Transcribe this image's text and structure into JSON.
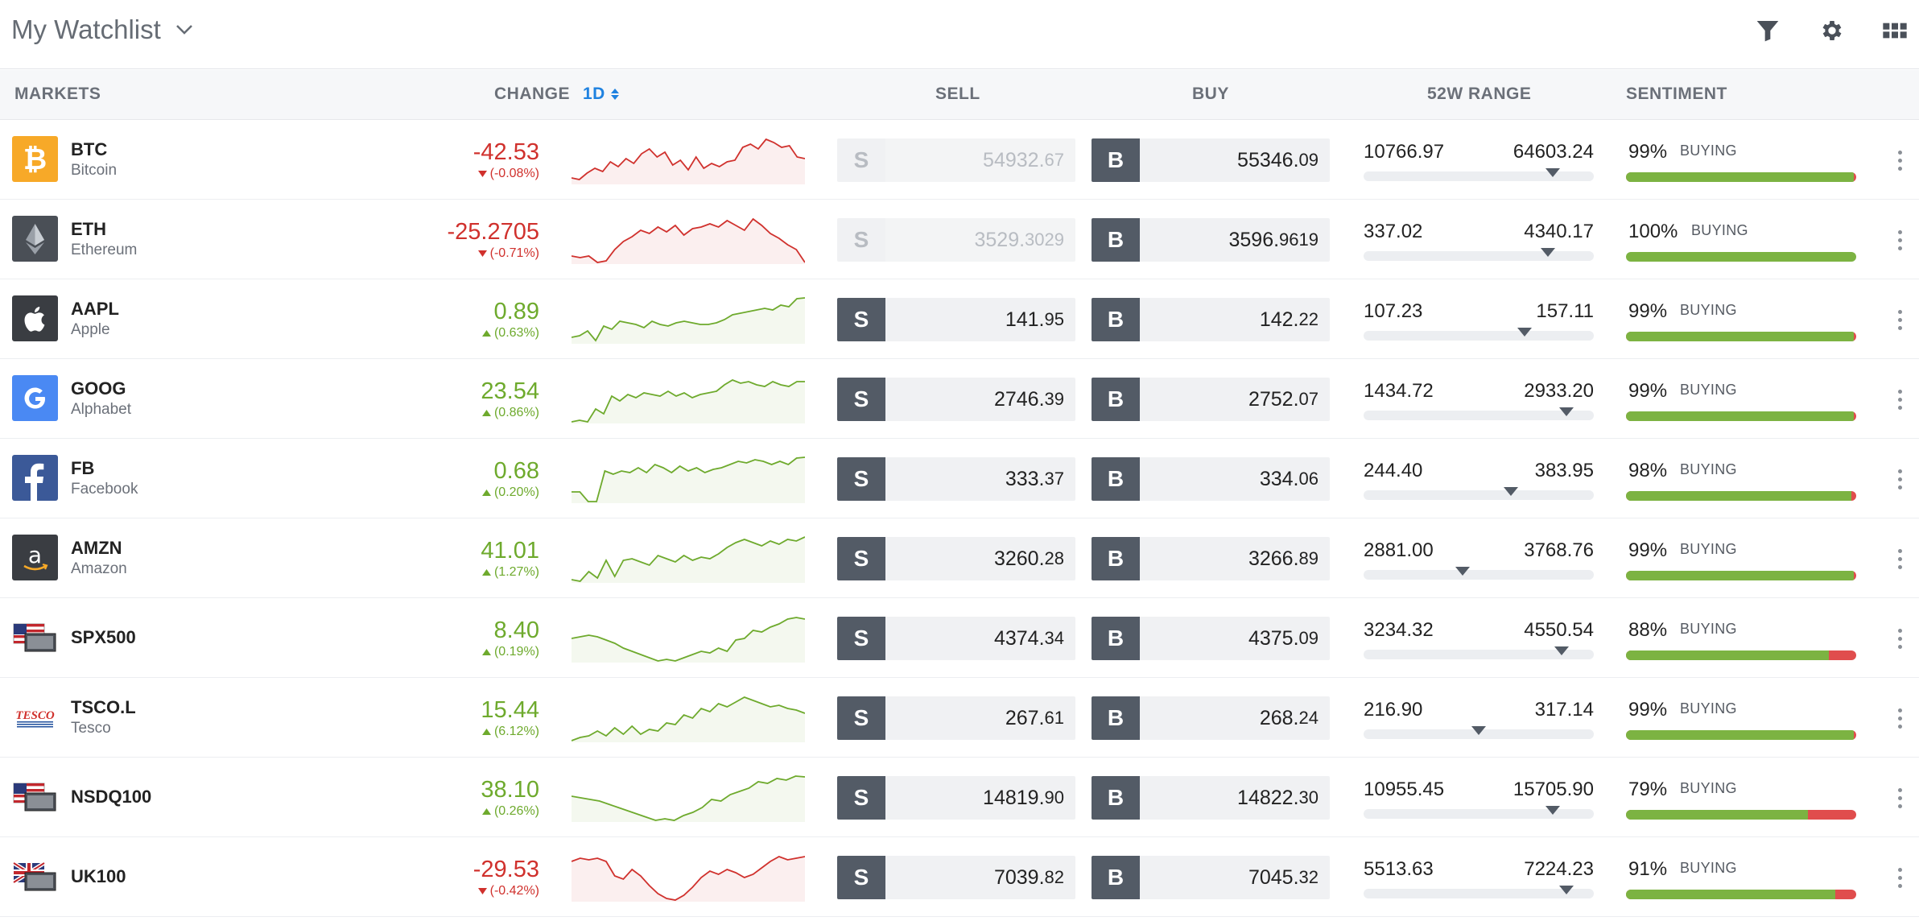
{
  "header": {
    "title": "My Watchlist",
    "icons": [
      "filter-icon",
      "gear-icon",
      "grid-icon"
    ]
  },
  "columns": {
    "markets": "MARKETS",
    "change": "CHANGE",
    "period": "1D",
    "sell": "SELL",
    "buy": "BUY",
    "range": "52W RANGE",
    "sentiment": "SENTIMENT"
  },
  "colors": {
    "positive": "#6eaa2d",
    "negative": "#d0312d",
    "button": "#535b66",
    "sentiment_buy": "#7cb342",
    "sentiment_sell": "#e04d4d"
  },
  "rows": [
    {
      "symbol": "BTC",
      "name": "Bitcoin",
      "logo": "bitcoin-logo-icon",
      "change": "-42.53",
      "change_pct": "(-0.08%)",
      "direction": "down",
      "sell_label": "S",
      "sell_main": "54932.",
      "sell_tail": "67",
      "sell_disabled": true,
      "buy_label": "B",
      "buy_main": "55346.",
      "buy_tail": "09",
      "range_low": "10766.97",
      "range_high": "64603.24",
      "range_pos": 0.82,
      "sentiment_pct": "99%",
      "sentiment_label": "BUYING",
      "sentiment_value": 99,
      "spark": [
        50,
        52,
        44,
        38,
        42,
        30,
        36,
        26,
        32,
        20,
        14,
        24,
        18,
        34,
        28,
        40,
        24,
        38,
        32,
        36,
        30,
        28,
        12,
        8,
        14,
        2,
        6,
        12,
        10,
        24,
        26
      ]
    },
    {
      "symbol": "ETH",
      "name": "Ethereum",
      "logo": "ethereum-logo-icon",
      "change": "-25.2705",
      "change_pct": "(-0.71%)",
      "direction": "down",
      "sell_label": "S",
      "sell_main": "3529.",
      "sell_tail": "3029",
      "sell_disabled": true,
      "buy_label": "B",
      "buy_main": "3596.",
      "buy_tail": "9619",
      "range_low": "337.02",
      "range_high": "4340.17",
      "range_pos": 0.8,
      "sentiment_pct": "100%",
      "sentiment_label": "BUYING",
      "sentiment_value": 100,
      "spark": [
        48,
        50,
        48,
        56,
        54,
        40,
        30,
        24,
        16,
        20,
        12,
        18,
        10,
        22,
        14,
        12,
        8,
        12,
        4,
        10,
        16,
        2,
        10,
        20,
        26,
        34,
        40,
        56
      ]
    },
    {
      "symbol": "AAPL",
      "name": "Apple",
      "logo": "apple-logo-icon",
      "change": "0.89",
      "change_pct": "(0.63%)",
      "direction": "up",
      "sell_label": "S",
      "sell_main": "141.",
      "sell_tail": "95",
      "sell_disabled": false,
      "buy_label": "B",
      "buy_main": "142.",
      "buy_tail": "22",
      "range_low": "107.23",
      "range_high": "157.11",
      "range_pos": 0.7,
      "sentiment_pct": "99%",
      "sentiment_label": "BUYING",
      "sentiment_value": 99,
      "spark": [
        50,
        48,
        42,
        54,
        36,
        40,
        30,
        32,
        34,
        38,
        30,
        34,
        36,
        32,
        30,
        32,
        34,
        34,
        32,
        28,
        22,
        20,
        18,
        16,
        14,
        16,
        10,
        12,
        2,
        0
      ]
    },
    {
      "symbol": "GOOG",
      "name": "Alphabet",
      "logo": "google-logo-icon",
      "change": "23.54",
      "change_pct": "(0.86%)",
      "direction": "up",
      "sell_label": "S",
      "sell_main": "2746.",
      "sell_tail": "39",
      "sell_disabled": false,
      "buy_label": "B",
      "buy_main": "2752.",
      "buy_tail": "07",
      "range_low": "1434.72",
      "range_high": "2933.20",
      "range_pos": 0.88,
      "sentiment_pct": "99%",
      "sentiment_label": "BUYING",
      "sentiment_value": 99,
      "spark": [
        56,
        54,
        56,
        40,
        46,
        24,
        30,
        22,
        26,
        20,
        22,
        24,
        18,
        24,
        20,
        26,
        22,
        20,
        18,
        10,
        4,
        8,
        6,
        10,
        12,
        6,
        10,
        12,
        6,
        6
      ]
    },
    {
      "symbol": "FB",
      "name": "Facebook",
      "logo": "facebook-logo-icon",
      "change": "0.68",
      "change_pct": "(0.20%)",
      "direction": "up",
      "sell_label": "S",
      "sell_main": "333.",
      "sell_tail": "37",
      "sell_disabled": false,
      "buy_label": "B",
      "buy_main": "334.",
      "buy_tail": "06",
      "range_low": "244.40",
      "range_high": "383.95",
      "range_pos": 0.64,
      "sentiment_pct": "98%",
      "sentiment_label": "BUYING",
      "sentiment_value": 98,
      "spark": [
        44,
        44,
        56,
        56,
        18,
        22,
        18,
        20,
        14,
        20,
        10,
        14,
        20,
        12,
        18,
        14,
        20,
        16,
        14,
        10,
        6,
        8,
        4,
        6,
        10,
        6,
        10,
        2,
        0
      ]
    },
    {
      "symbol": "AMZN",
      "name": "Amazon",
      "logo": "amazon-logo-icon",
      "change": "41.01",
      "change_pct": "(1.27%)",
      "direction": "up",
      "sell_label": "S",
      "sell_main": "3260.",
      "sell_tail": "28",
      "sell_disabled": false,
      "buy_label": "B",
      "buy_main": "3266.",
      "buy_tail": "89",
      "range_low": "2881.00",
      "range_high": "3768.76",
      "range_pos": 0.43,
      "sentiment_pct": "99%",
      "sentiment_label": "BUYING",
      "sentiment_value": 99,
      "spark": [
        54,
        56,
        44,
        52,
        30,
        50,
        30,
        28,
        32,
        36,
        24,
        28,
        32,
        24,
        30,
        26,
        28,
        22,
        14,
        8,
        4,
        8,
        12,
        6,
        10,
        4,
        6,
        0
      ]
    },
    {
      "symbol": "SPX500",
      "name": "",
      "logo": "us-flag-icon",
      "change": "8.40",
      "change_pct": "(0.19%)",
      "direction": "up",
      "sell_label": "S",
      "sell_main": "4374.",
      "sell_tail": "34",
      "sell_disabled": false,
      "buy_label": "B",
      "buy_main": "4375.",
      "buy_tail": "09",
      "range_low": "3234.32",
      "range_high": "4550.54",
      "range_pos": 0.86,
      "sentiment_pct": "88%",
      "sentiment_label": "BUYING",
      "sentiment_value": 88,
      "spark": [
        28,
        26,
        24,
        26,
        30,
        34,
        40,
        44,
        48,
        52,
        56,
        54,
        56,
        52,
        48,
        44,
        46,
        40,
        44,
        30,
        28,
        18,
        20,
        14,
        10,
        4,
        2,
        4
      ]
    },
    {
      "symbol": "TSCO.L",
      "name": "Tesco",
      "logo": "tesco-logo-icon",
      "change": "15.44",
      "change_pct": "(6.12%)",
      "direction": "up",
      "sell_label": "S",
      "sell_main": "267.",
      "sell_tail": "61",
      "sell_disabled": false,
      "buy_label": "B",
      "buy_main": "268.",
      "buy_tail": "24",
      "range_low": "216.90",
      "range_high": "317.14",
      "range_pos": 0.5,
      "sentiment_pct": "99%",
      "sentiment_label": "BUYING",
      "sentiment_value": 99,
      "spark": [
        56,
        52,
        50,
        44,
        50,
        40,
        48,
        38,
        48,
        42,
        44,
        34,
        36,
        24,
        28,
        16,
        20,
        10,
        14,
        8,
        2,
        6,
        10,
        14,
        12,
        16,
        18,
        22
      ]
    },
    {
      "symbol": "NSDQ100",
      "name": "",
      "logo": "us-flag-icon",
      "change": "38.10",
      "change_pct": "(0.26%)",
      "direction": "up",
      "sell_label": "S",
      "sell_main": "14819.",
      "sell_tail": "90",
      "sell_disabled": false,
      "buy_label": "B",
      "buy_main": "14822.",
      "buy_tail": "30",
      "range_low": "10955.45",
      "range_high": "15705.90",
      "range_pos": 0.82,
      "sentiment_pct": "79%",
      "sentiment_label": "BUYING",
      "sentiment_value": 79,
      "spark": [
        26,
        28,
        30,
        32,
        36,
        40,
        44,
        48,
        52,
        56,
        54,
        56,
        50,
        46,
        40,
        30,
        32,
        24,
        20,
        16,
        8,
        10,
        4,
        6,
        0,
        2
      ]
    },
    {
      "symbol": "UK100",
      "name": "",
      "logo": "uk-flag-icon",
      "change": "-29.53",
      "change_pct": "(-0.42%)",
      "direction": "down",
      "sell_label": "S",
      "sell_main": "7039.",
      "sell_tail": "82",
      "sell_disabled": false,
      "buy_label": "B",
      "buy_main": "7045.",
      "buy_tail": "32",
      "range_low": "5513.63",
      "range_high": "7224.23",
      "range_pos": 0.88,
      "sentiment_pct": "91%",
      "sentiment_label": "BUYING",
      "sentiment_value": 91,
      "spark": [
        8,
        4,
        6,
        4,
        8,
        26,
        30,
        18,
        26,
        38,
        48,
        54,
        56,
        50,
        40,
        28,
        20,
        24,
        18,
        22,
        28,
        24,
        16,
        8,
        2,
        6,
        4,
        2
      ]
    }
  ]
}
